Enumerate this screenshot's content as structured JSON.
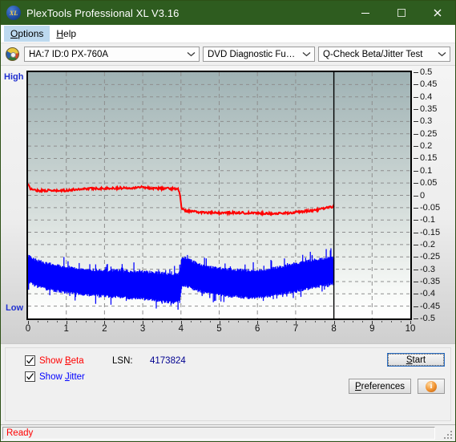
{
  "window": {
    "title": "PlexTools Professional XL V3.16",
    "icon": "xl-app-icon",
    "icon_text": "XL",
    "titlebar_color": "#2e5c1f",
    "buttons": {
      "minimize": "minimize-icon",
      "maximize": "maximize-icon",
      "close": "close-icon"
    }
  },
  "menu": {
    "items": [
      {
        "label": "Options",
        "accel": "O",
        "active": true
      },
      {
        "label": "Help",
        "accel": "H",
        "active": false
      }
    ]
  },
  "selectors": {
    "drive_icon": "optical-disc-icon",
    "drive": {
      "value": "HA:7 ID:0  PX-760A"
    },
    "function": {
      "value": "DVD Diagnostic Functions"
    },
    "test": {
      "value": "Q-Check Beta/Jitter Test"
    },
    "arrow": "chevron-down-icon"
  },
  "chart_labels": {
    "high": "High",
    "low": "Low"
  },
  "controls": {
    "show_beta": {
      "label_pre": "Show ",
      "label_accel": "B",
      "label_post": "eta",
      "checked": true,
      "color": "#ff0000"
    },
    "show_jitter": {
      "label_pre": "Show ",
      "label_accel": "J",
      "label_post": "itter",
      "checked": true,
      "color": "#0000ff"
    },
    "lsn_label": "LSN:",
    "lsn_value": "4173824",
    "start_button": {
      "label_pre": "",
      "label_accel": "S",
      "label_post": "tart",
      "focused": true
    },
    "preferences_button": {
      "label_pre": "",
      "label_accel": "P",
      "label_post": "references"
    },
    "info_button": {
      "icon": "info-icon",
      "glyph": "i"
    }
  },
  "statusbar": {
    "text": "Ready",
    "color": "#ff0000"
  },
  "chart_data": {
    "type": "line",
    "title": "Q-Check Beta/Jitter Test",
    "xlabel": "",
    "ylabel": "",
    "xlim": [
      0,
      10
    ],
    "ylim": [
      -0.5,
      0.5
    ],
    "xticks": [
      0,
      1,
      2,
      3,
      4,
      5,
      6,
      7,
      8,
      9,
      10
    ],
    "yticks": [
      0.5,
      0.45,
      0.4,
      0.35,
      0.3,
      0.25,
      0.2,
      0.15,
      0.1,
      0.05,
      0,
      -0.05,
      -0.1,
      -0.15,
      -0.2,
      -0.25,
      -0.3,
      -0.35,
      -0.4,
      -0.45,
      -0.5
    ],
    "grid": true,
    "legend_position": "below-left",
    "axis_left_label": "High",
    "axis_left_label_bottom": "Low",
    "cursor_x": 8,
    "data_end_x": 8,
    "series": [
      {
        "name": "Beta",
        "color": "#ff0000",
        "type": "line",
        "x": [
          0.0,
          0.05,
          0.15,
          0.3,
          0.5,
          0.75,
          1.0,
          1.25,
          1.5,
          1.75,
          2.0,
          2.25,
          2.5,
          2.75,
          3.0,
          3.2,
          3.4,
          3.6,
          3.8,
          3.92,
          3.97,
          4.02,
          4.1,
          4.3,
          4.6,
          5.0,
          5.4,
          5.8,
          6.2,
          6.6,
          7.0,
          7.3,
          7.6,
          7.85,
          8.0
        ],
        "y": [
          0.045,
          0.028,
          0.022,
          0.019,
          0.02,
          0.018,
          0.02,
          0.024,
          0.027,
          0.028,
          0.028,
          0.029,
          0.03,
          0.031,
          0.034,
          0.029,
          0.028,
          0.028,
          0.027,
          0.026,
          0.01,
          -0.055,
          -0.062,
          -0.066,
          -0.07,
          -0.072,
          -0.07,
          -0.072,
          -0.073,
          -0.074,
          -0.069,
          -0.064,
          -0.058,
          -0.05,
          -0.046
        ]
      },
      {
        "name": "Jitter",
        "color": "#0000ff",
        "type": "band",
        "x": [
          0.0,
          0.1,
          0.2,
          0.3,
          0.45,
          0.6,
          0.8,
          1.0,
          1.2,
          1.45,
          1.7,
          2.0,
          2.3,
          2.6,
          2.9,
          3.2,
          3.5,
          3.75,
          3.9,
          3.97,
          4.02,
          4.1,
          4.25,
          4.45,
          4.7,
          5.0,
          5.3,
          5.6,
          5.9,
          6.2,
          6.5,
          6.8,
          7.1,
          7.35,
          7.6,
          7.8,
          8.0
        ],
        "y_upper": [
          -0.25,
          -0.258,
          -0.268,
          -0.272,
          -0.282,
          -0.285,
          -0.292,
          -0.296,
          -0.3,
          -0.306,
          -0.308,
          -0.312,
          -0.31,
          -0.314,
          -0.316,
          -0.318,
          -0.322,
          -0.326,
          -0.324,
          -0.32,
          -0.262,
          -0.258,
          -0.27,
          -0.284,
          -0.296,
          -0.302,
          -0.306,
          -0.31,
          -0.312,
          -0.308,
          -0.3,
          -0.29,
          -0.28,
          -0.272,
          -0.266,
          -0.262,
          -0.258
        ],
        "y_lower": [
          -0.345,
          -0.352,
          -0.362,
          -0.368,
          -0.374,
          -0.378,
          -0.384,
          -0.388,
          -0.392,
          -0.396,
          -0.4,
          -0.404,
          -0.406,
          -0.41,
          -0.414,
          -0.418,
          -0.424,
          -0.43,
          -0.43,
          -0.426,
          -0.366,
          -0.36,
          -0.37,
          -0.382,
          -0.392,
          -0.398,
          -0.404,
          -0.408,
          -0.412,
          -0.406,
          -0.398,
          -0.39,
          -0.38,
          -0.372,
          -0.364,
          -0.358,
          -0.354
        ]
      }
    ]
  }
}
